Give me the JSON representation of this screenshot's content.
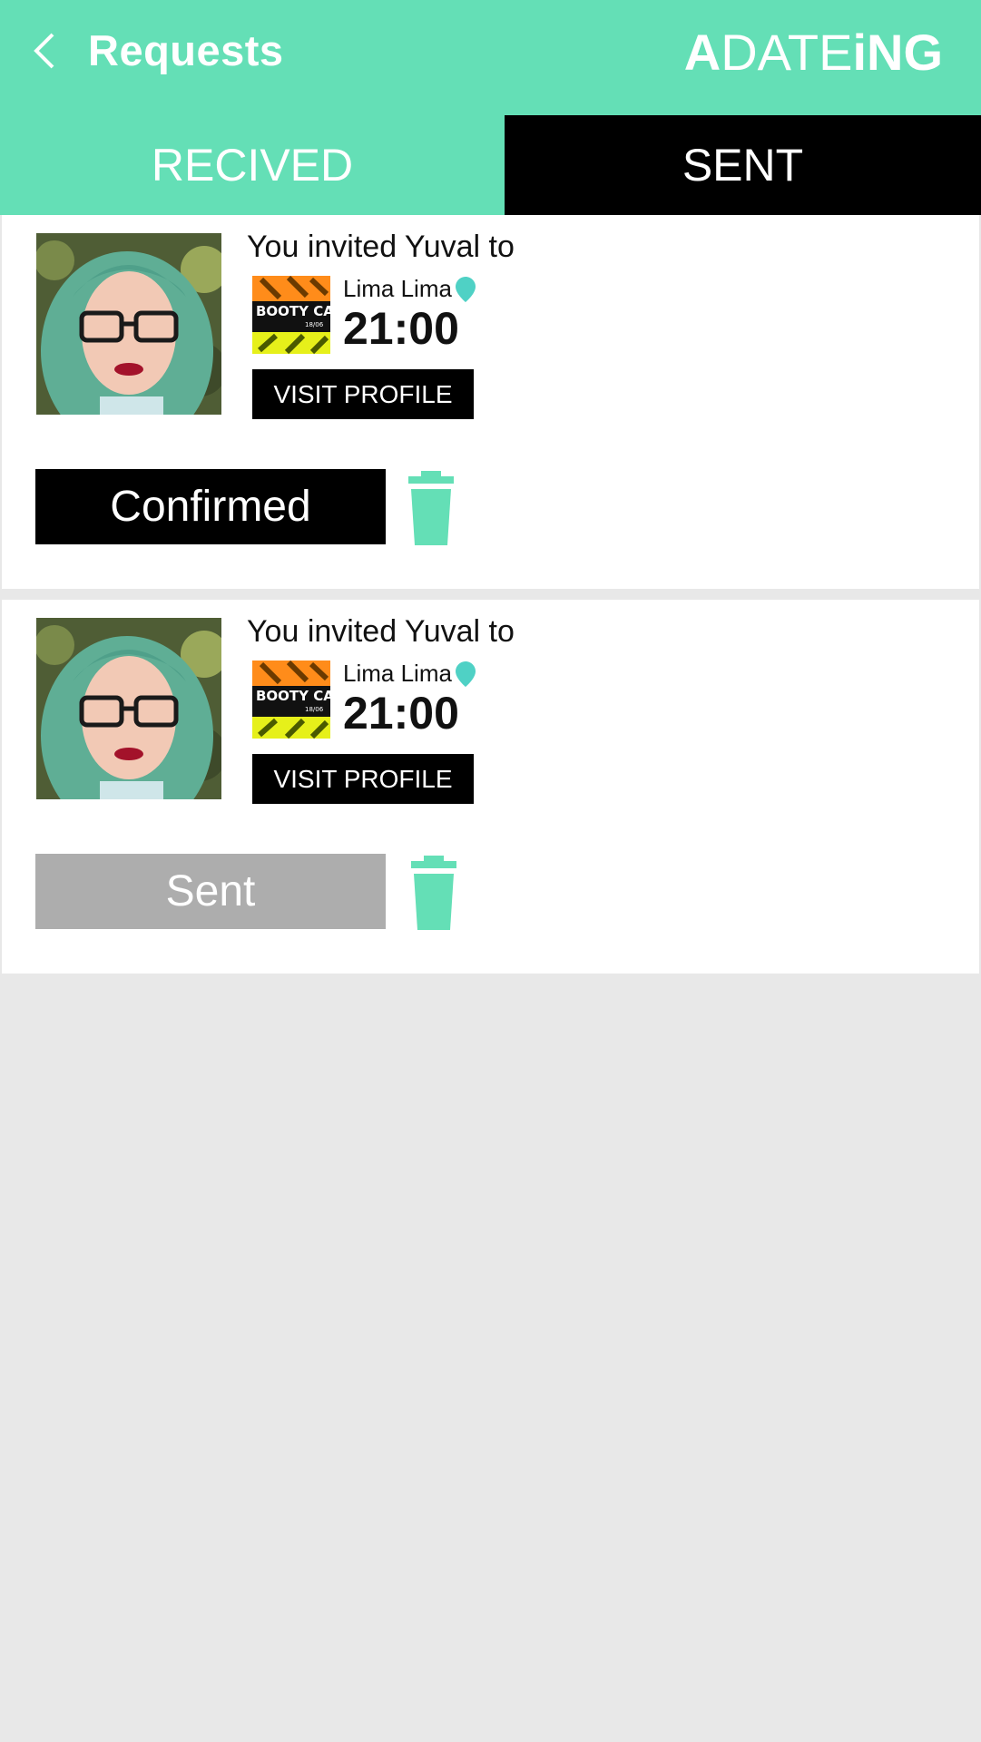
{
  "header": {
    "title": "Requests",
    "logo_a": "A",
    "logo_date": "DATE",
    "logo_ing": "iNG",
    "background": "#64dfb6"
  },
  "tabs": [
    {
      "label": "RECIVED",
      "active": false
    },
    {
      "label": "SENT",
      "active": true
    }
  ],
  "requests": [
    {
      "invite_text": "You invited Yuval to",
      "event_image": "BOOTY CALL",
      "event_date": "18/06",
      "venue": "Lima Lima",
      "time": "21:00",
      "visit_label": "VISIT PROFILE",
      "status": "Confirmed"
    },
    {
      "invite_text": "You invited Yuval to",
      "event_image": "BOOTY CALL",
      "event_date": "18/06",
      "venue": "Lima Lima",
      "time": "21:00",
      "visit_label": "VISIT PROFILE",
      "status": "Sent"
    }
  ],
  "colors": {
    "accent": "#64dfb6",
    "pin": "#4fd1c5",
    "sent_status": "#adadad"
  }
}
